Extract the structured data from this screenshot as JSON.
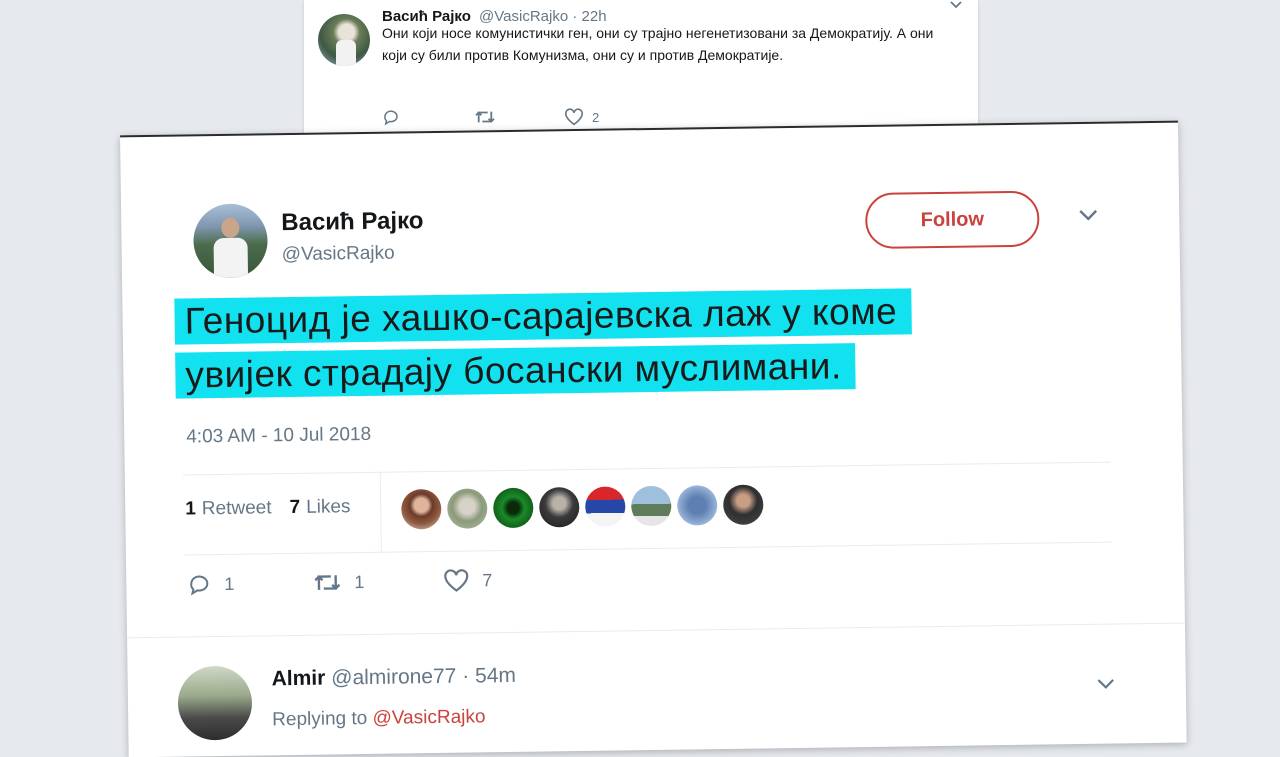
{
  "top_tweet": {
    "name": "Васић Рајко",
    "handle": "@VasicRajko",
    "time": "· 22h",
    "text": "Они који носе комунистички ген, они су трајно негенетизовани за Демократију. А они који су били против Комунизма, они су и против Демократије.",
    "likes": "2"
  },
  "main_tweet": {
    "name": "Васић Рајко",
    "handle": "@VasicRajko",
    "follow_label": "Follow",
    "text_line1": "Геноцид је хашко-сарајевска лаж у коме",
    "text_line2": "увијек страдају босански муслимани.",
    "timestamp": "4:03 AM - 10 Jul 2018",
    "retweets_count": "1",
    "retweets_label": "Retweet",
    "likes_count": "7",
    "likes_label": "Likes",
    "reply_count": "1",
    "retweet_action_count": "1",
    "like_action_count": "7",
    "highlight_color": "#12e2f0"
  },
  "reply": {
    "name": "Almir",
    "handle": "@almirone77",
    "time": "· 54m",
    "replying_prefix": "Replying to",
    "replying_handle": "@VasicRajko"
  }
}
